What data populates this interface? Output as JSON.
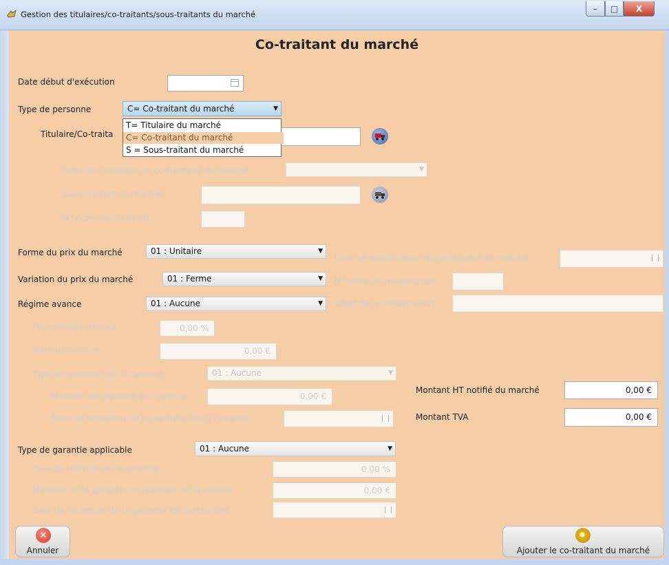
{
  "window": {
    "title": "Gestion des titulaires/co-traitants/sous-traitants du marché",
    "controls": {
      "minimize": "–",
      "maximize": "□",
      "close": "X"
    }
  },
  "heading": "Co-traitant du marché",
  "fields": {
    "date_debut_label": "Date début d'exécution",
    "type_personne_label": "Type de personne",
    "type_personne_value": "C= Co-traitant du marché",
    "type_personne_options": [
      "T= Titulaire du marché",
      "C= Co-traitant du marché",
      "S = Sous-traitant du marché"
    ],
    "titulaire_label": "Titulaire/Co-traita",
    "liste_titulaires_label": "Liste des titulaires ou co-traitants du marché",
    "sous_traitant_label": "Sous-traitant du marché",
    "acte_label": "N° Acte sous-traitant",
    "forme_prix_label": "Forme du prix du marché",
    "forme_prix_value": "01 : Unitaire",
    "variation_prix_label": "Variation du prix du marché",
    "variation_prix_value": "01 : Ferme",
    "regime_avance_label": "Régime avance",
    "regime_avance_value": "01 : Aucune",
    "pourcentage_avance_label": "Pourcentage avance",
    "pourcentage_avance_value": "0,00 %",
    "montant_avance_label": "Montant avance",
    "montant_avance_value": "0,00 €",
    "type_garantie_avance_label": "Type de garantie liée à l'avance",
    "type_garantie_avance_value": "01 : Aucune",
    "montant_garantie_avance_label": "Montant de garantie de l'avance",
    "montant_garantie_avance_value": "0,00 €",
    "date_reception_garantie_avance_label": "Date de réception de la garantie liée à l'avance",
    "type_garantie_applicable_label": "Type de garantie applicable",
    "type_garantie_applicable_value": "01 : Aucune",
    "taux_retenue_label": "Taux de retenue de la garantie",
    "taux_retenue_value": "0,00 %",
    "montant_garantie_label": "Montant de la garantie ou montant de la caution",
    "montant_garantie_value": "0,00 €",
    "date_reception_contractant_label": "Date de réception de la garantie du contractant",
    "date_modification_label": "Date de modification du participant au marché",
    "ordre_modification_label": "N° ordre de modification",
    "objet_modification_label": "Objet de la modification",
    "montant_ht_label": "Montant HT notifié du marché",
    "montant_ht_value": "0,00 €",
    "montant_tva_label": "Montant TVA",
    "montant_tva_value": "0,00 €"
  },
  "buttons": {
    "annuler": "Annuler",
    "ajouter": "Ajouter le co-traitant du marché"
  },
  "colors": {
    "panel": "#f5cea8",
    "dropdown_hover": "#f5cea8",
    "accent_red": "#d83a2a"
  }
}
